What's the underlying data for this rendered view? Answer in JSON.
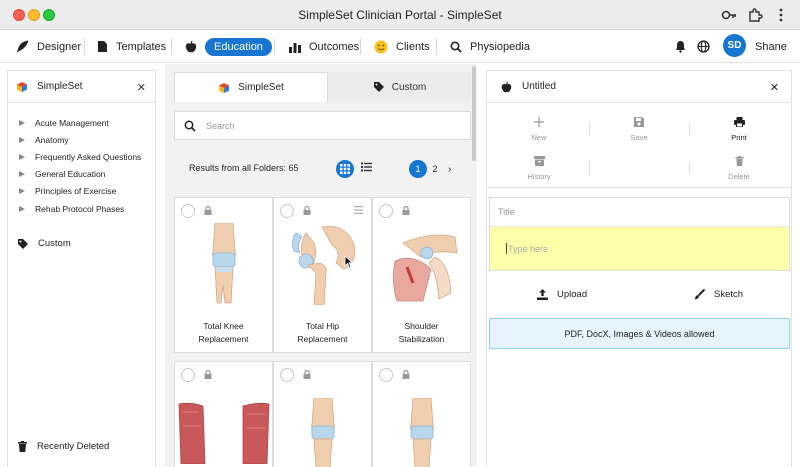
{
  "window": {
    "title": "SimpleSet Clinician Portal - SimpleSet"
  },
  "nav": {
    "designer": "Designer",
    "templates": "Templates",
    "education": "Education",
    "outcomes": "Outcomes",
    "clients": "Clients",
    "physiopedia": "Physiopedia",
    "user_initials": "SD",
    "user_name": "Shane"
  },
  "left_panel": {
    "title": "SimpleSet",
    "folders": [
      "Acute Management",
      "Anatomy",
      "Frequently Asked Questions",
      "General Education",
      "Principles of Exercise",
      "Rehab Protocol Phases"
    ],
    "custom": "Custom",
    "recently_deleted": "Recently Deleted"
  },
  "middle": {
    "tabs": [
      "SimpleSet",
      "Custom"
    ],
    "search_placeholder": "Search",
    "results_text": "Results from all Folders: 65",
    "pages": [
      "1",
      "2"
    ],
    "cards": [
      {
        "label_line1": "Total Knee",
        "label_line2": "Replacement"
      },
      {
        "label_line1": "Total Hip",
        "label_line2": "Replacement"
      },
      {
        "label_line1": "Shoulder",
        "label_line2": "Stabilization"
      }
    ]
  },
  "right_panel": {
    "title": "Untitled",
    "tools": {
      "new": "New",
      "save": "Save",
      "print": "Print",
      "history": "History",
      "delete": "Delete"
    },
    "title_placeholder": "Title",
    "body_placeholder": "Type here",
    "upload": "Upload",
    "sketch": "Sketch",
    "allowed_text": "PDF, DocX, Images & Videos allowed"
  },
  "colors": {
    "accent": "#1676d2",
    "editor_bg": "#ffffa9",
    "info_bg": "#e6f5fd"
  }
}
